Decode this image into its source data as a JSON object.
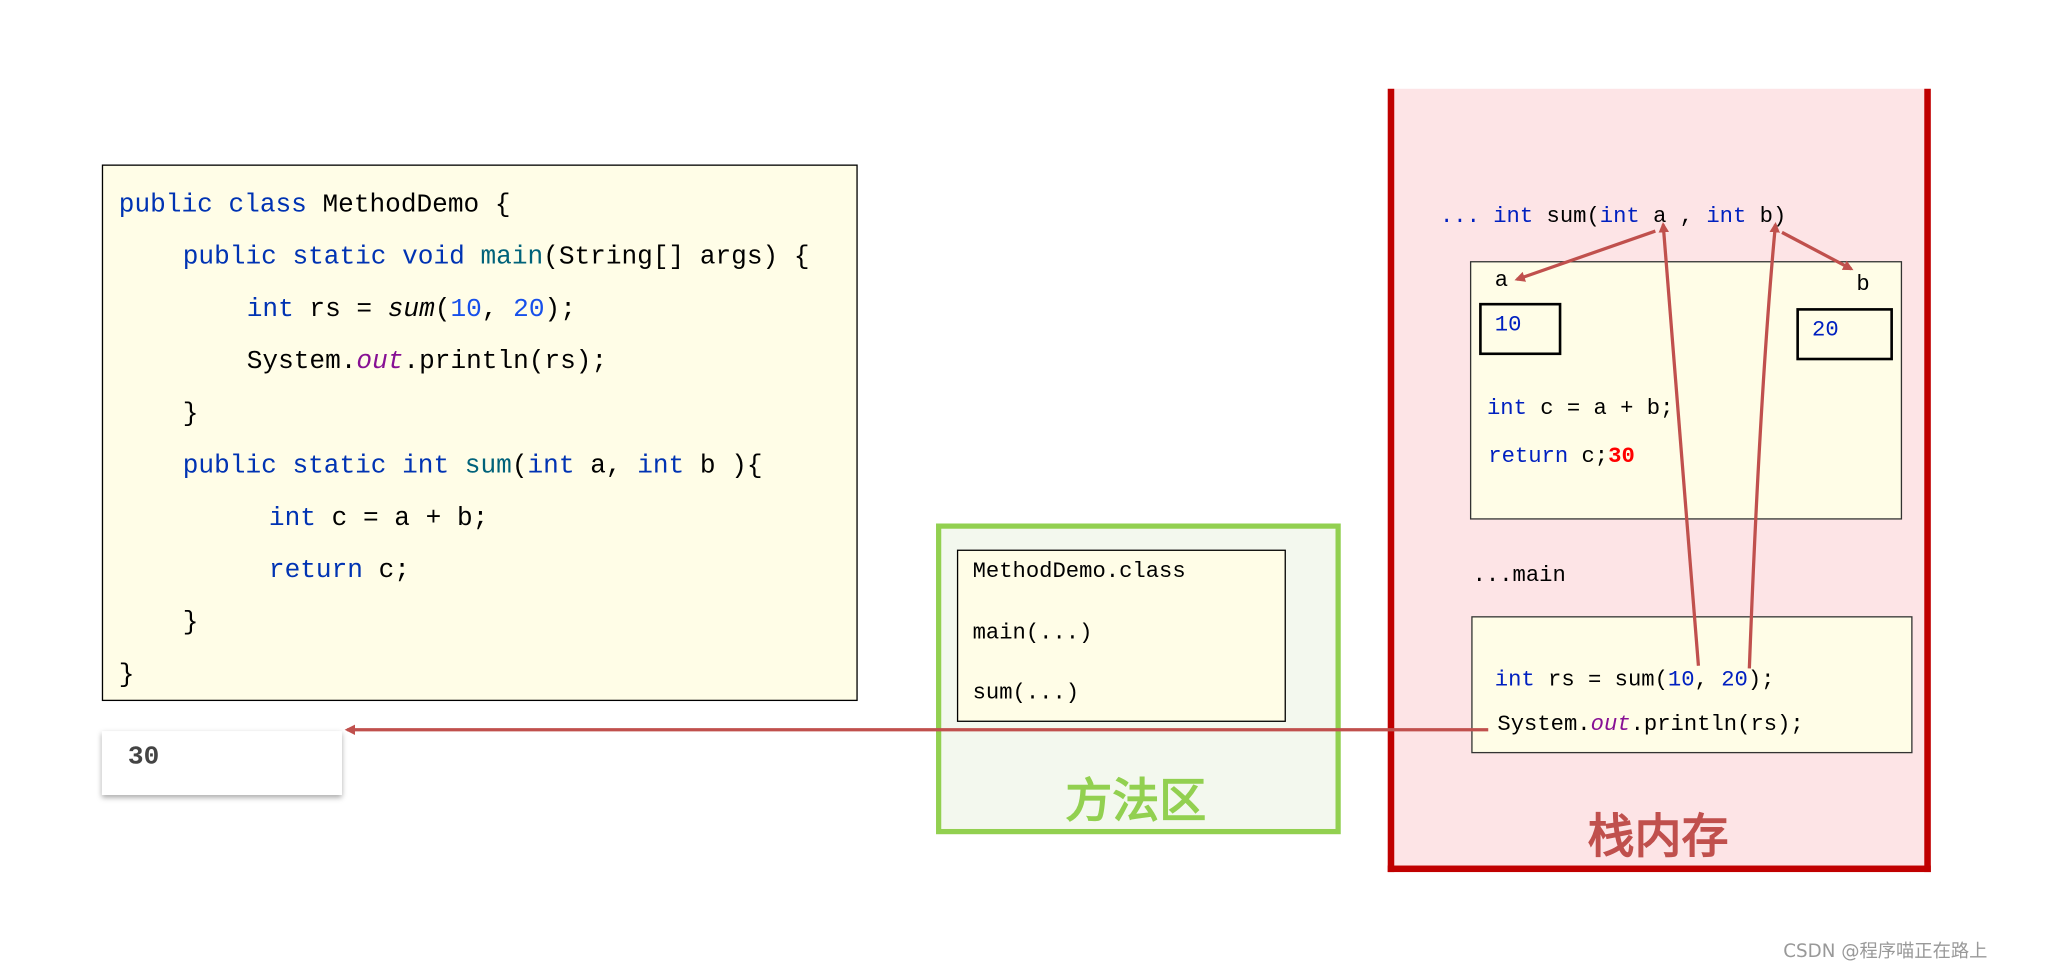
{
  "colors": {
    "keyword": "#0033b3",
    "method": "#00627a",
    "number": "#1750eb",
    "field": "#871094",
    "method_area_border": "#92d050",
    "stack_border": "#c00000",
    "arrow": "#c0504d",
    "code_bg": "#fffde7"
  },
  "code": {
    "lines": [
      [
        {
          "t": "public class ",
          "k": "kw"
        },
        {
          "t": "MethodDemo {",
          "k": ""
        }
      ],
      [
        {
          "t": "public static void ",
          "k": "kw"
        },
        {
          "t": "main",
          "k": "fn"
        },
        {
          "t": "(String[] args) {",
          "k": ""
        }
      ],
      [
        {
          "t": "int ",
          "k": "kw"
        },
        {
          "t": "rs = ",
          "k": ""
        },
        {
          "t": "sum",
          "k": "it"
        },
        {
          "t": "(",
          "k": ""
        },
        {
          "t": "10",
          "k": "num"
        },
        {
          "t": ", ",
          "k": ""
        },
        {
          "t": "20",
          "k": "num"
        },
        {
          "t": ");",
          "k": ""
        }
      ],
      [
        {
          "t": "System.",
          "k": ""
        },
        {
          "t": "out",
          "k": "fld"
        },
        {
          "t": ".println(rs);",
          "k": ""
        }
      ],
      [
        {
          "t": "}",
          "k": ""
        }
      ],
      [
        {
          "t": "public static int ",
          "k": "kw"
        },
        {
          "t": "sum",
          "k": "fn"
        },
        {
          "t": "(",
          "k": ""
        },
        {
          "t": "int ",
          "k": "kw"
        },
        {
          "t": "a, ",
          "k": ""
        },
        {
          "t": "int ",
          "k": "kw"
        },
        {
          "t": "b ){",
          "k": ""
        }
      ],
      [
        {
          "t": "int ",
          "k": "kw"
        },
        {
          "t": "c = a + b;",
          "k": ""
        }
      ],
      [
        {
          "t": "return ",
          "k": "kw"
        },
        {
          "t": "c;",
          "k": ""
        }
      ],
      [
        {
          "t": "}",
          "k": ""
        }
      ],
      [
        {
          "t": "}",
          "k": ""
        }
      ]
    ]
  },
  "console_output": "30",
  "method_area": {
    "label": "方法区",
    "items": [
      "MethodDemo.class",
      "main(...)",
      "sum(...)"
    ]
  },
  "stack": {
    "label": "栈内存",
    "sum_signature": {
      "prefix": "... ",
      "kw1": "int ",
      "name": "sum(",
      "kw2": "int ",
      "a": "a , ",
      "kw3": "int ",
      "b": "b)"
    },
    "sum_frame": {
      "param_a": "a",
      "param_b": "b",
      "value_a": "10",
      "value_b": "20",
      "line1": {
        "kw": "int ",
        "rest": "c = a + b;"
      },
      "line2": {
        "kw": "return ",
        "rest": "c;",
        "result": "30"
      }
    },
    "main_label": "...main",
    "main_frame": {
      "line1": {
        "kw": "int ",
        "rest": "rs = sum(",
        "n1": "10",
        "sep": ", ",
        "n2": "20",
        "end": ");"
      },
      "line2": {
        "pre": "System.",
        "field": "out",
        "post": ".println(rs);"
      }
    }
  },
  "watermark": "CSDN @程序喵正在路上"
}
